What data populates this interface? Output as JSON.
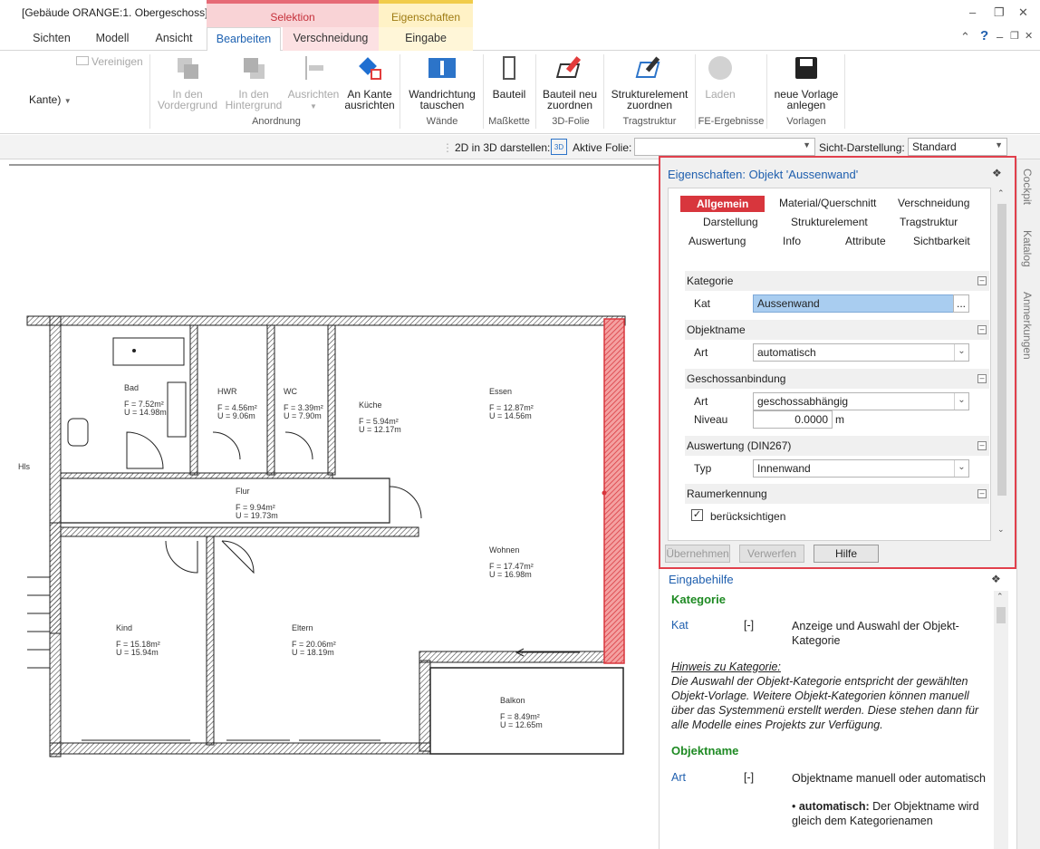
{
  "window": {
    "title": "[Gebäude ORANGE:1. Obergeschoss]",
    "context_groups": [
      "Selektion",
      "Eigenschaften"
    ]
  },
  "tabs": [
    "Sichten",
    "Modell",
    "Ansicht",
    "Bearbeiten",
    "Verschneidung",
    "Eingabe"
  ],
  "active_tab": "Bearbeiten",
  "ribbon": {
    "left_partial": {
      "vereinigen": "Vereinigen",
      "kante": "Kante)"
    },
    "buttons": {
      "vordergrund": [
        "In den",
        "Vordergrund"
      ],
      "hintergrund": [
        "In den",
        "Hintergrund"
      ],
      "ausrichten": [
        "Ausrichten",
        ""
      ],
      "ankante": [
        "An Kante",
        "ausrichten"
      ],
      "wandrichtung": [
        "Wandrichtung",
        "tauschen"
      ],
      "bauteil": [
        "Bauteil",
        ""
      ],
      "bauteilneu": [
        "Bauteil neu",
        "zuordnen"
      ],
      "strukturelement": [
        "Strukturelement",
        "zuordnen"
      ],
      "laden": [
        "Laden",
        ""
      ],
      "neuevorlage": [
        "neue Vorlage",
        "anlegen"
      ]
    },
    "groups": [
      "Anordnung",
      "Wände",
      "Maßkette",
      "3D-Folie",
      "Tragstruktur",
      "FE-Ergebnisse",
      "Vorlagen"
    ]
  },
  "statusbar": {
    "label_2d3d": "2D in 3D darstellen:",
    "icon_3d": "3D",
    "label_folie": "Aktive Folie:",
    "folie_value": "",
    "label_sicht": "Sicht-Darstellung:",
    "sicht_value": "Standard"
  },
  "properties": {
    "title": "Eigenschaften: Objekt 'Aussenwand'",
    "tabs": {
      "allgemein": "Allgemein",
      "material": "Material/Querschnitt",
      "verschneidung": "Verschneidung",
      "darstellung": "Darstellung",
      "strukturelement": "Strukturelement",
      "tragstruktur": "Tragstruktur",
      "auswertung": "Auswertung",
      "info": "Info",
      "attribute": "Attribute",
      "sichtbarkeit": "Sichtbarkeit"
    },
    "sections": {
      "kategorie": "Kategorie",
      "objektname": "Objektname",
      "geschoss": "Geschossanbindung",
      "auswertung": "Auswertung (DIN267)",
      "raum": "Raumerkennung"
    },
    "fields": {
      "kat_label": "Kat",
      "kat_value": "Aussenwand",
      "kat_btn": "...",
      "art1_label": "Art",
      "art1_value": "automatisch",
      "art2_label": "Art",
      "art2_value": "geschossabhängig",
      "niveau_label": "Niveau",
      "niveau_value": "0.0000",
      "niveau_unit": "m",
      "typ_label": "Typ",
      "typ_value": "Innenwand",
      "check_label": "berücksichtigen",
      "check_state": "checked"
    },
    "buttons": {
      "uebernehmen": "Übernehmen",
      "verwerfen": "Verwerfen",
      "hilfe": "Hilfe"
    }
  },
  "help": {
    "title": "Eingabehilfe",
    "h1": "Kategorie",
    "kat_key": "Kat",
    "kat_br": "[-]",
    "kat_text": "Anzeige und Auswahl der Objekt-Kategorie",
    "hint_title": "Hinweis zu Kategorie:",
    "hint_text": "Die Auswahl der Objekt-Kategorie entspricht der gewählten Objekt-Vorlage. Weitere Objekt-Kategorien können manuell über das Systemmenü erstellt werden. Diese stehen dann für alle Modelle eines Projekts zur Verfügung.",
    "h2": "Objektname",
    "art_key": "Art",
    "art_br": "[-]",
    "art_text": "Objektname manuell oder automatisch",
    "bullet_bold": "automatisch:",
    "bullet_text": "Der Objektname wird gleich dem Kategorienamen"
  },
  "side_tabs": [
    "Cockpit",
    "Katalog",
    "Anmerkungen"
  ],
  "rooms": [
    {
      "name": "Bad",
      "f": "F = 7.52m²",
      "u": "U = 14.98m"
    },
    {
      "name": "HWR",
      "f": "F = 4.56m²",
      "u": "U = 9.06m"
    },
    {
      "name": "WC",
      "f": "F = 3.39m²",
      "u": "U = 7.90m"
    },
    {
      "name": "Küche",
      "f": "F = 5.94m²",
      "u": "U = 12.17m"
    },
    {
      "name": "Essen",
      "f": "F = 12.87m²",
      "u": "U = 14.56m"
    },
    {
      "name": "Flur",
      "f": "F = 9.94m²",
      "u": "U = 19.73m"
    },
    {
      "name": "Wohnen",
      "f": "F = 17.47m²",
      "u": "U = 16.98m"
    },
    {
      "name": "Kind",
      "f": "F = 15.18m²",
      "u": "U = 15.94m"
    },
    {
      "name": "Eltern",
      "f": "F = 20.06m²",
      "u": "U = 18.19m"
    },
    {
      "name": "Balkon",
      "f": "F = 8.49m²",
      "u": "U = 12.65m"
    },
    {
      "name": "Hls",
      "f": "",
      "u": ""
    }
  ],
  "colors": {
    "accent_blue": "#1f5fae",
    "selection_red": "#e1404c",
    "help_green": "#1e8a23",
    "kat_highlight": "#a9cdf0"
  }
}
